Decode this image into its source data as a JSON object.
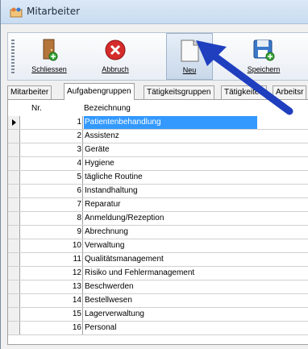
{
  "window": {
    "title": "Mitarbeiter"
  },
  "toolbar": {
    "buttons": [
      {
        "label": "Schliessen",
        "icon": "door-exit-icon"
      },
      {
        "label": "Abbruch",
        "icon": "cancel-icon"
      },
      {
        "label": "Neu",
        "icon": "new-document-icon"
      },
      {
        "label": "Speichern",
        "icon": "save-icon"
      }
    ]
  },
  "tabs": [
    {
      "label": "Mitarbeiter"
    },
    {
      "label": "Aufgabengruppen",
      "active": true
    },
    {
      "label": "Tätigkeitsgruppen"
    },
    {
      "label": "Tätigkeiten"
    },
    {
      "label": "Arbeitsr"
    }
  ],
  "grid": {
    "columns": [
      "Nr.",
      "Bezeichnung"
    ],
    "rows": [
      {
        "nr": "1",
        "bez": "Patientenbehandlung"
      },
      {
        "nr": "2",
        "bez": "Assistenz"
      },
      {
        "nr": "3",
        "bez": "Geräte"
      },
      {
        "nr": "4",
        "bez": "Hygiene"
      },
      {
        "nr": "5",
        "bez": "tägliche Routine"
      },
      {
        "nr": "6",
        "bez": "Instandhaltung"
      },
      {
        "nr": "7",
        "bez": "Reparatur"
      },
      {
        "nr": "8",
        "bez": "Anmeldung/Rezeption"
      },
      {
        "nr": "9",
        "bez": "Abrechnung"
      },
      {
        "nr": "10",
        "bez": "Verwaltung"
      },
      {
        "nr": "11",
        "bez": "Qualitätsmanagement"
      },
      {
        "nr": "12",
        "bez": "Risiko und Fehlermanagement"
      },
      {
        "nr": "13",
        "bez": "Beschwerden"
      },
      {
        "nr": "14",
        "bez": "Bestellwesen"
      },
      {
        "nr": "15",
        "bez": "Lagerverwaltung"
      },
      {
        "nr": "16",
        "bez": "Personal"
      }
    ]
  },
  "colors": {
    "selection": "#3399ff",
    "annotation_arrow": "#1f3fbf"
  }
}
